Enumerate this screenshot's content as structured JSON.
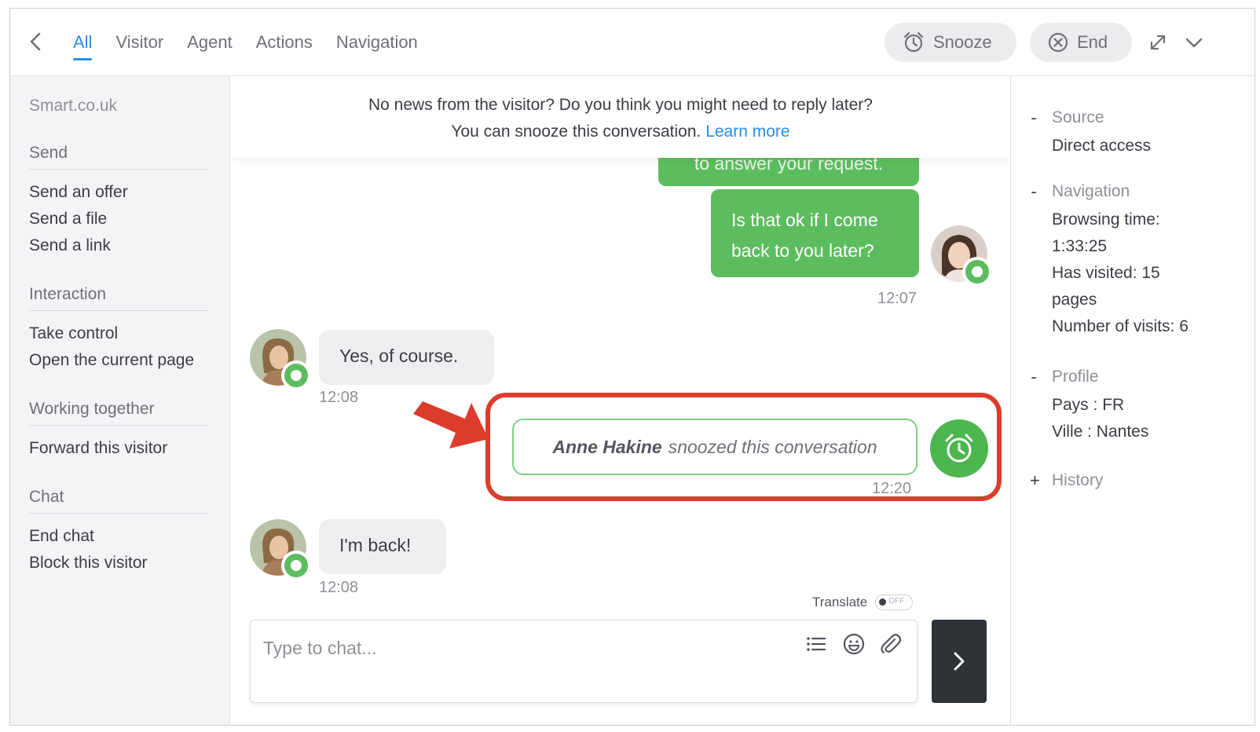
{
  "header": {
    "tabs": [
      "All",
      "Visitor",
      "Agent",
      "Actions",
      "Navigation"
    ],
    "snooze_label": "Snooze",
    "end_label": "End"
  },
  "sidebar": {
    "site": "Smart.co.uk",
    "sections": [
      {
        "title": "Send",
        "items": [
          "Send an offer",
          "Send a file",
          "Send a link"
        ]
      },
      {
        "title": "Interaction",
        "items": [
          "Take control",
          "Open the current page"
        ]
      },
      {
        "title": "Working together",
        "items": [
          "Forward this visitor"
        ]
      },
      {
        "title": "Chat",
        "items": [
          "End chat",
          "Block this visitor"
        ]
      }
    ]
  },
  "banner": {
    "line1": "No news from the visitor? Do you think you might need to reply later?",
    "line2": "You can snooze this conversation.",
    "learn_more": "Learn more"
  },
  "messages": {
    "partial_agent": "to answer your request.",
    "agent_msg": "Is that ok if I come back to you later?",
    "agent_time": "12:07",
    "visitor_msg1": "Yes, of course.",
    "visitor_time1": "12:08",
    "snooze_name": "Anne Hakine",
    "snooze_text": "snoozed this conversation",
    "snooze_time": "12:20",
    "visitor_msg2": "I'm back!",
    "visitor_time2": "12:08"
  },
  "composer": {
    "translate_label": "Translate",
    "toggle_state": "OFF",
    "placeholder": "Type to chat..."
  },
  "right_panel": {
    "source": {
      "title": "Source",
      "lines": [
        "Direct access"
      ]
    },
    "navigation": {
      "title": "Navigation",
      "lines": [
        "Browsing time:",
        "1:33:25",
        "Has visited: 15",
        "pages",
        "Number of visits: 6"
      ]
    },
    "profile": {
      "title": "Profile",
      "lines": [
        "Pays : FR",
        "Ville : Nantes"
      ]
    },
    "history": {
      "title": "History"
    }
  },
  "colors": {
    "accent_blue": "#2b8de8",
    "agent_green": "#5cbd5e",
    "highlight_red": "#dc3c2c",
    "send_dark": "#2f3236"
  }
}
